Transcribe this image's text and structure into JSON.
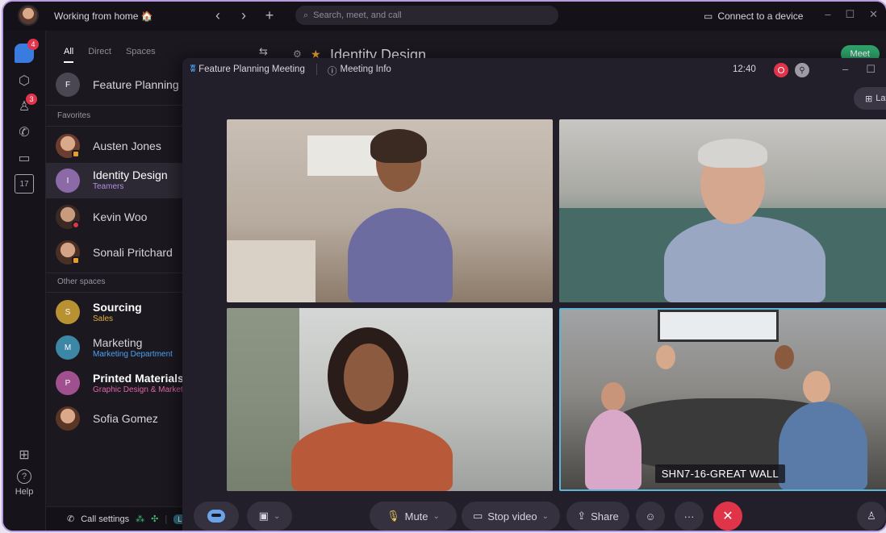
{
  "app": {
    "status_text": "Working from home 🏠",
    "search_placeholder": "Search, meet, and call",
    "connect_label": "Connect to a device",
    "window_min": "–",
    "window_max": "☐",
    "window_close": "✕"
  },
  "rail": {
    "chat_badge": "4",
    "people_badge": "3",
    "calendar_day": "17",
    "help_label": "Help"
  },
  "spaces": {
    "filters": [
      "All",
      "Direct",
      "Spaces"
    ],
    "top_item": {
      "initial": "F",
      "name": "Feature Planning M"
    },
    "favorites_label": "Favorites",
    "favorites": [
      {
        "name": "Austen Jones"
      },
      {
        "initial": "I",
        "name": "Identity Design",
        "sub": "Teamers"
      },
      {
        "name": "Kevin Woo"
      },
      {
        "name": "Sonali Pritchard"
      }
    ],
    "other_label": "Other spaces",
    "others": [
      {
        "initial": "S",
        "name": "Sourcing",
        "sub": "Sales"
      },
      {
        "initial": "M",
        "name": "Marketing",
        "sub": "Marketing Department"
      },
      {
        "initial": "P",
        "name": "Printed Materials",
        "sub": "Graphic Design & Marketing"
      },
      {
        "name": "Sofia Gomez"
      }
    ],
    "call_settings": "Call settings",
    "line_badge": "L1",
    "line_text": "M"
  },
  "space_header": {
    "title": "Identity Design",
    "meet_label": "Meet"
  },
  "meeting": {
    "title": "Feature Planning Meeting",
    "info_label": "Meeting Info",
    "clock": "12:40",
    "layout_label": "Lay",
    "room_label": "SHN7-16-GREAT WALL",
    "controls": {
      "mute": "Mute",
      "stop_video": "Stop video",
      "share": "Share",
      "more": "···",
      "end": "✕"
    }
  },
  "colors": {
    "accent_blue": "#3a7be0",
    "meet_green": "#2ea36b",
    "end_red": "#e0344a",
    "active_speaker": "#5ab5d8"
  }
}
